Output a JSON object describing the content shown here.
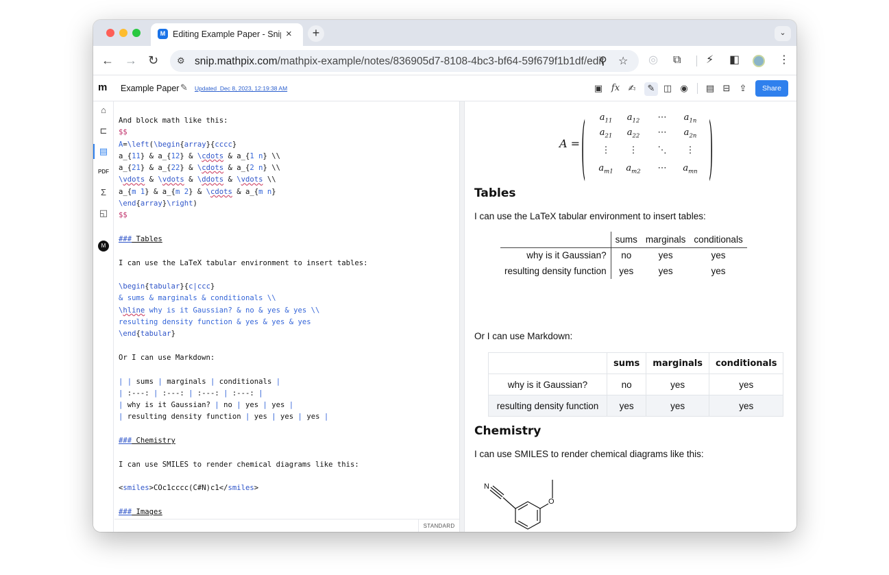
{
  "browser": {
    "tab_title": "Editing Example Paper - Snip",
    "tab_favicon": "M",
    "tab_close": "×",
    "new_tab": "+",
    "tab_menu": "⌄",
    "url_host": "snip.mathpix.com",
    "url_path": "/mathpix-example/notes/836905d7-8108-4bc3-bf64-59f679f1b1df/edit",
    "icons": [
      "back-arrow-icon",
      "forward-arrow-icon",
      "reload-icon",
      "site-info-icon",
      "zoom-icon",
      "bookmark-star-icon",
      "extension-icon",
      "puzzle-icon",
      "performance-icon",
      "sidepanel-icon",
      "profile-icon",
      "menu-icon"
    ]
  },
  "app": {
    "logo": "m",
    "doc_title": "Example Paper",
    "updated_label": "Updated",
    "updated_date": "Dec 8, 2023, 12:19:38 AM",
    "share_label": "Share",
    "user_initial": "M",
    "status_mode": "STANDARD",
    "brand_color": "#2f80ed"
  },
  "editor": {
    "lines": [
      "And block math like this:",
      "$$",
      "A=\\left(\\begin{array}{cccc}",
      "a_{11} & a_{12} & \\cdots & a_{1 n} \\\\",
      "a_{21} & a_{22} & \\cdots & a_{2 n} \\\\",
      "\\vdots & \\vdots & \\ddots & \\vdots \\\\",
      "a_{m 1} & a_{m 2} & \\cdots & a_{m n}",
      "\\end{array}\\right)",
      "$$",
      "",
      "### Tables",
      "",
      "I can use the LaTeX tabular environment to insert tables:",
      "",
      "\\begin{tabular}{c|ccc}",
      "& sums & marginals & conditionals \\\\",
      "\\hline why is it Gaussian? & no & yes & yes \\\\",
      "resulting density function & yes & yes & yes",
      "\\end{tabular}",
      "",
      "Or I can use Markdown:",
      "",
      "| | sums | marginals | conditionals |",
      "| :---: | :---: | :---: | :---: |",
      "| why is it Gaussian? | no | yes | yes |",
      "| resulting density function | yes | yes | yes |",
      "",
      "### Chemistry",
      "",
      "I can use SMILES to render chemical diagrams like this:",
      "",
      "<smiles>COc1cccc(C#N)c1</smiles>",
      "",
      "### Images"
    ]
  },
  "preview": {
    "matrix": {
      "lhs": "A =",
      "rows": [
        [
          "a11",
          "a12",
          "⋯",
          "a1n"
        ],
        [
          "a21",
          "a22",
          "⋯",
          "a2n"
        ],
        [
          "⋮",
          "⋮",
          "⋱",
          "⋮"
        ],
        [
          "am1",
          "am2",
          "⋯",
          "amn"
        ]
      ]
    },
    "tables_heading": "Tables",
    "tables_intro": "I can use the LaTeX tabular environment to insert tables:",
    "latex_table": {
      "headers": [
        "",
        "sums",
        "marginals",
        "conditionals"
      ],
      "rows": [
        [
          "why is it Gaussian?",
          "no",
          "yes",
          "yes"
        ],
        [
          "resulting density function",
          "yes",
          "yes",
          "yes"
        ]
      ]
    },
    "markdown_intro": "Or I can use Markdown:",
    "md_table": {
      "headers": [
        "",
        "sums",
        "marginals",
        "conditionals"
      ],
      "rows": [
        [
          "why is it Gaussian?",
          "no",
          "yes",
          "yes"
        ],
        [
          "resulting density function",
          "yes",
          "yes",
          "yes"
        ]
      ]
    },
    "chem_heading": "Chemistry",
    "chem_intro": "I can use SMILES to render chemical diagrams like this:",
    "molecule_atoms": {
      "nitrogen": "N",
      "oxygen": "O"
    }
  }
}
